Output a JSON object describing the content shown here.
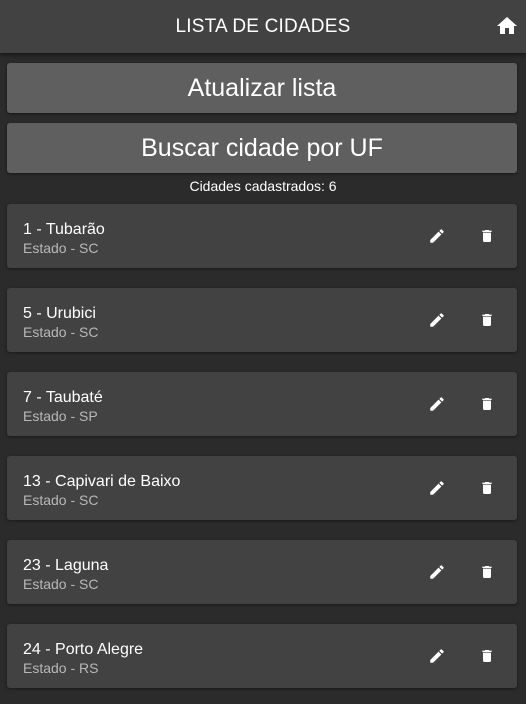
{
  "header": {
    "title": "LISTA DE CIDADES",
    "home_icon": "home-icon"
  },
  "actions": {
    "refresh_label": "Atualizar lista",
    "search_label": "Buscar cidade por UF"
  },
  "summary": {
    "count_text": "Cidades cadastrados: 6"
  },
  "cities": [
    {
      "title": "1 - Tubarão",
      "state": "Estado - SC"
    },
    {
      "title": "5 - Urubici",
      "state": "Estado - SC"
    },
    {
      "title": "7 - Taubaté",
      "state": "Estado - SP"
    },
    {
      "title": "13 - Capivari de Baixo",
      "state": "Estado - SC"
    },
    {
      "title": "23 - Laguna",
      "state": "Estado - SC"
    },
    {
      "title": "24 - Porto Alegre",
      "state": "Estado - RS"
    }
  ],
  "icons": {
    "edit": "pencil-icon",
    "delete": "trash-icon"
  },
  "colors": {
    "background": "#2b2b2b",
    "header": "#424242",
    "button": "#5f5f5f",
    "card": "#424242",
    "text": "#ffffff",
    "subtext": "#b8b8b8"
  }
}
